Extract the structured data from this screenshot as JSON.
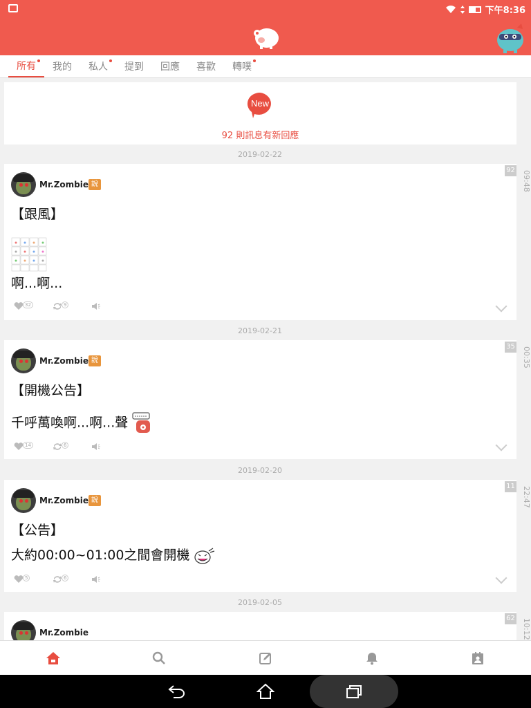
{
  "status": {
    "time": "下午8:36"
  },
  "tabs": [
    {
      "label": "所有",
      "dot": true,
      "active": true
    },
    {
      "label": "我的",
      "dot": false,
      "active": false
    },
    {
      "label": "私人",
      "dot": true,
      "active": false
    },
    {
      "label": "提到",
      "dot": false,
      "active": false
    },
    {
      "label": "回應",
      "dot": false,
      "active": false
    },
    {
      "label": "喜歡",
      "dot": false,
      "active": false
    },
    {
      "label": "轉噗",
      "dot": true,
      "active": false
    }
  ],
  "new_card": {
    "badge": "New",
    "text": "92 則訊息有新回應"
  },
  "posts": [
    {
      "date": "2019-02-22",
      "time": "09:48",
      "count": "92",
      "author": "Mr.Zombie",
      "qualifier": "說",
      "line1": "【跟風】",
      "line2": "啊...啊...",
      "likes": "32",
      "replurks": "9"
    },
    {
      "date": "2019-02-21",
      "time": "00:35",
      "count": "35",
      "author": "Mr.Zombie",
      "qualifier": "說",
      "line1": "【開機公告】",
      "line2": "千呼萬喚啊...啊...聲",
      "likes": "14",
      "replurks": "6"
    },
    {
      "date": "2019-02-20",
      "time": "22:47",
      "count": "11",
      "author": "Mr.Zombie",
      "qualifier": "說",
      "line1": "【公告】",
      "line2": "大約00:00~01:00之間會開機",
      "likes": "5",
      "replurks": "6"
    },
    {
      "date": "2019-02-05",
      "time": "10:12",
      "count": "62",
      "author": "Mr.Zombie"
    }
  ],
  "colors": {
    "brand": "#f05a4e",
    "accent": "#e84d40",
    "qualifier": "#e8953c"
  },
  "icons": {
    "bottom_nav": [
      "home-icon",
      "search-icon",
      "compose-icon",
      "bell-icon",
      "profile-card-icon"
    ],
    "system": [
      "back-icon",
      "home-outline-icon",
      "recents-icon"
    ]
  }
}
